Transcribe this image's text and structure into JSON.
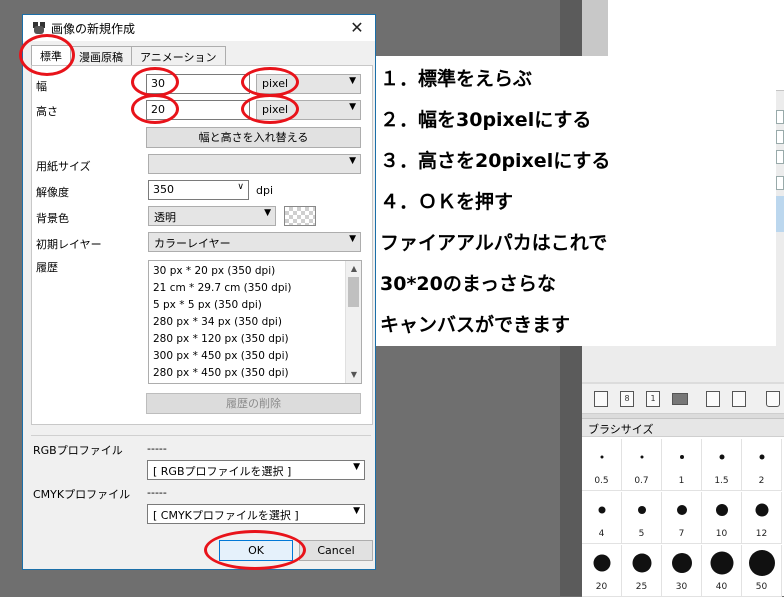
{
  "dialog": {
    "title": "画像の新規作成",
    "close_glyph": "✕",
    "tabs": [
      {
        "label": "標準"
      },
      {
        "label": "漫画原稿"
      },
      {
        "label": "アニメーション"
      }
    ],
    "width": {
      "label": "幅",
      "value": "30",
      "unit": "pixel"
    },
    "height": {
      "label": "高さ",
      "value": "20",
      "unit": "pixel"
    },
    "swap_button": "幅と高さを入れ替える",
    "paper_size": {
      "label": "用紙サイズ",
      "value": ""
    },
    "resolution": {
      "label": "解像度",
      "value": "350",
      "unit": "dpi"
    },
    "bg_color": {
      "label": "背景色",
      "value": "透明"
    },
    "initial_layer": {
      "label": "初期レイヤー",
      "value": "カラーレイヤー"
    },
    "history": {
      "label": "履歴",
      "items": [
        "30 px * 20 px (350 dpi)",
        "21 cm * 29.7 cm (350 dpi)",
        "5 px * 5 px (350 dpi)",
        "280 px * 34 px (350 dpi)",
        "280 px * 120 px (350 dpi)",
        "300 px * 450 px (350 dpi)",
        "280 px * 450 px (350 dpi)"
      ],
      "clear_button": "履歴の削除"
    },
    "rgb_profile": {
      "label": "RGBプロファイル",
      "current": "-----",
      "select": "[ RGBプロファイルを選択 ]"
    },
    "cmyk_profile": {
      "label": "CMYKプロファイル",
      "current": "-----",
      "select": "[ CMYKプロファイルを選択 ]"
    },
    "ok_button": "OK",
    "cancel_button": "Cancel"
  },
  "instructions": [
    "１．標準をえらぶ",
    "２．幅を30pixelにする",
    "３．高さを20pixelにする",
    "４．ＯＫを押す",
    "ファイアアルパカはこれで",
    "30*20のまっさらな",
    "キャンバスができます"
  ],
  "brush_panel": {
    "title": "ブラシサイズ",
    "sizes": [
      "0.5",
      "0.7",
      "1",
      "1.5",
      "2",
      "4",
      "5",
      "7",
      "10",
      "12",
      "20",
      "25",
      "30",
      "40",
      "50"
    ]
  },
  "colors": {
    "annotation_red": "#e8131a",
    "dialog_border": "#1b6fa8",
    "ok_accent": "#0078d7"
  }
}
